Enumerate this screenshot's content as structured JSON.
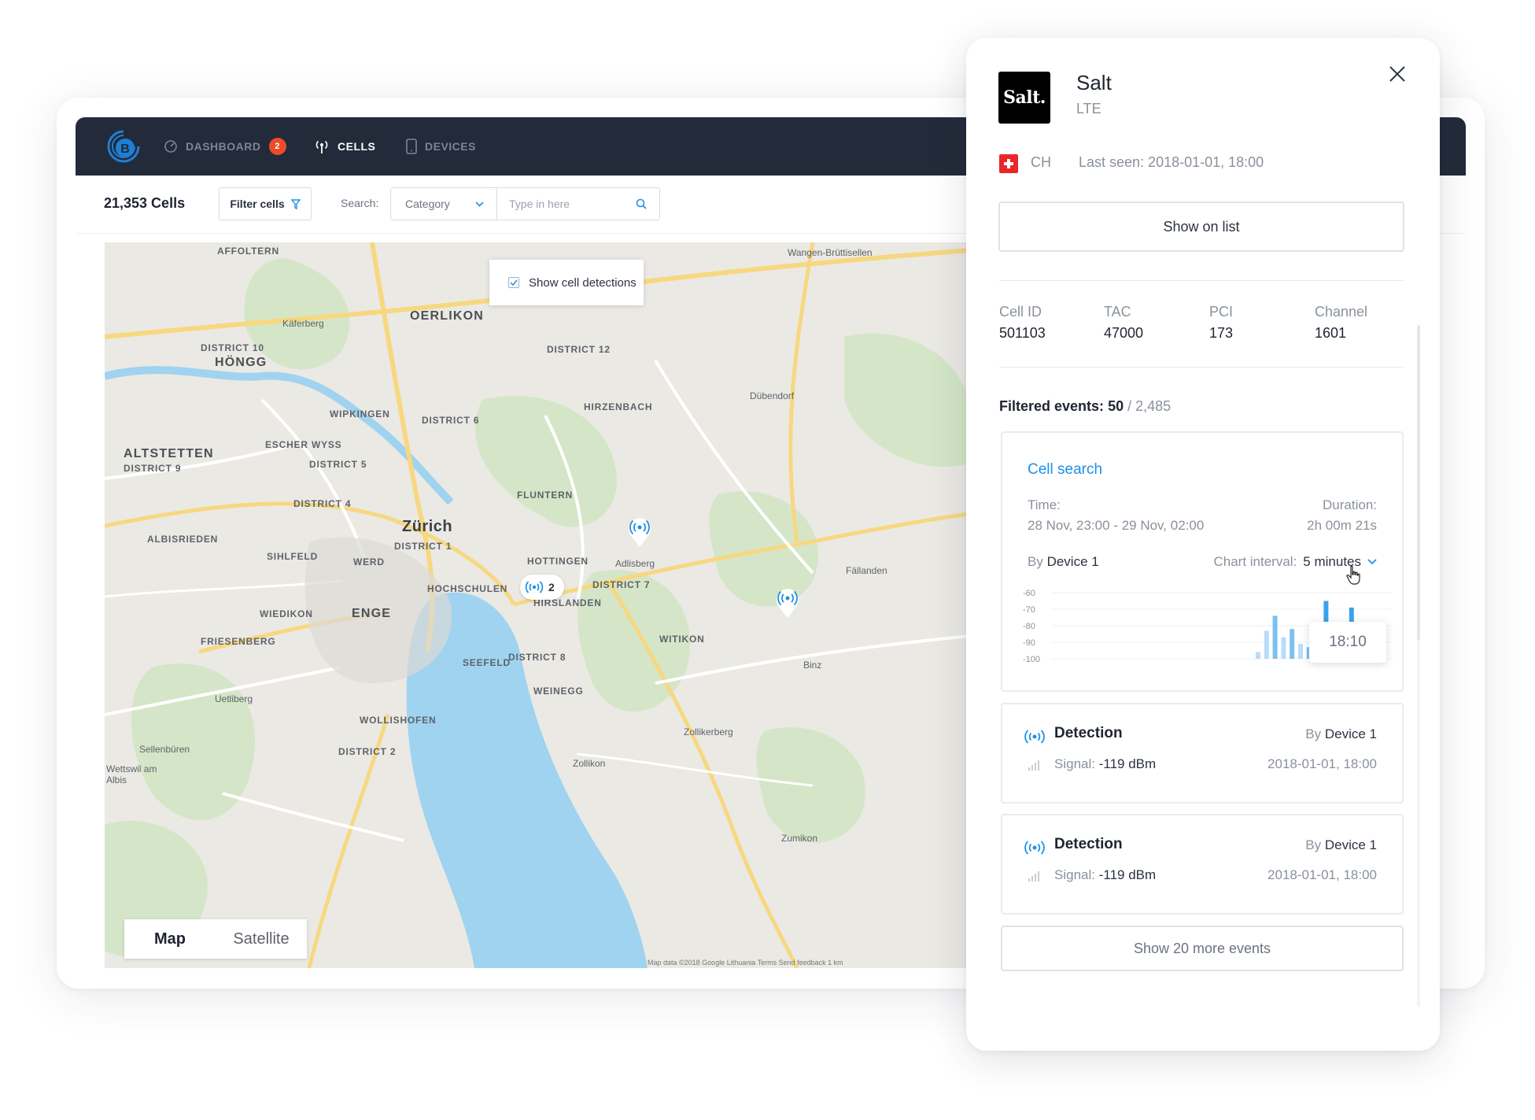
{
  "nav": {
    "items": [
      {
        "label": "DASHBOARD",
        "badge": "2"
      },
      {
        "label": "CELLS"
      },
      {
        "label": "DEVICES"
      }
    ]
  },
  "toolbar": {
    "cells_count": "21,353 Cells",
    "filter_label": "Filter cells",
    "search_label": "Search:",
    "category": "Category",
    "search_placeholder": "Type in here"
  },
  "map": {
    "show_detections_label": "Show cell detections",
    "show_detections_checked": true,
    "toggle": {
      "map": "Map",
      "satellite": "Satellite"
    },
    "cluster_count": "2",
    "attribution": "Map data ©2018 Google   Lithuania   Terms   Send feedback   1 km",
    "labels": {
      "affoltern": "AFFOLTERN",
      "oerlikon": "OERLIKON",
      "kaferberg": "Käferberg",
      "district10": "DISTRICT 10",
      "hongg": "HÖNGG",
      "district12": "DISTRICT 12",
      "wipkingen": "WIPKINGEN",
      "hirzenbach": "HIRZENBACH",
      "dubendorf": "Dübendorf",
      "district6": "DISTRICT 6",
      "escher": "ESCHER WYSS",
      "altstetten": "ALTSTETTEN",
      "district9": "DISTRICT 9",
      "district5": "DISTRICT 5",
      "fluntern": "FLUNTERN",
      "district4": "DISTRICT 4",
      "zurich": "Zürich",
      "district1": "DISTRICT 1",
      "albisrieden": "ALBISRIEDEN",
      "sihlfeld": "SIHLFELD",
      "werd": "WERD",
      "hottingen": "HOTTINGEN",
      "adlisberg": "Adlisberg",
      "fallanden": "Fällanden",
      "hochschulen": "HOCHSCHULEN",
      "hirslanden": "HIRSLANDEN",
      "district7": "DISTRICT 7",
      "wiedikon": "WIEDIKON",
      "enge": "ENGE",
      "friesenberg": "FRIESENBERG",
      "witikon": "WITIKON",
      "district8": "DISTRICT 8",
      "seefeld": "SEEFELD",
      "binz": "Binz",
      "weinegg": "WEINEGG",
      "uetliberg": "Uetliberg",
      "wollishofen": "WOLLISHOFEN",
      "zollikerberg": "Zollikerberg",
      "sellenburen": "Sellenbüren",
      "district2": "DISTRICT 2",
      "wettswil": "Wettswil am Albis",
      "zollikon": "Zollikon",
      "zumikon": "Zumikon",
      "wangen": "Wangen-Brüttisellen"
    }
  },
  "panel": {
    "operator_logo": "Salt.",
    "operator": "Salt",
    "technology": "LTE",
    "country": "CH",
    "last_seen": "Last seen: 2018-01-01, 18:00",
    "show_on_list": "Show on list",
    "meta": [
      {
        "key": "Cell ID",
        "value": "501103"
      },
      {
        "key": "TAC",
        "value": "47000"
      },
      {
        "key": "PCI",
        "value": "173"
      },
      {
        "key": "Channel",
        "value": "1601"
      }
    ],
    "filtered_label": "Filtered events:",
    "filtered_count": "50",
    "filtered_total": "/ 2,485",
    "cell_search": {
      "title": "Cell search",
      "time_label": "Time:",
      "time_value": "28 Nov, 23:00 - 29 Nov, 02:00",
      "duration_label": "Duration:",
      "duration_value": "2h 00m 21s",
      "by_label": "By",
      "device": "Device 1",
      "interval_label": "Chart interval:",
      "interval_value": "5 minutes",
      "tooltip": "18:10"
    },
    "detections": [
      {
        "title": "Detection",
        "by": "By",
        "device": "Device 1",
        "signal_label": "Signal:",
        "signal_value": "-119 dBm",
        "date": "2018-01-01, 18:00"
      },
      {
        "title": "Detection",
        "by": "By",
        "device": "Device 1",
        "signal_label": "Signal:",
        "signal_value": "-119 dBm",
        "date": "2018-01-01, 18:00"
      }
    ],
    "show_more": "Show 20 more events"
  },
  "chart_data": {
    "type": "bar",
    "ylim": [
      -100,
      -60
    ],
    "yticks": [
      "-60",
      "-70",
      "-80",
      "-90",
      "-100"
    ],
    "values": [
      -96,
      -83,
      -74,
      -87,
      -82,
      -91,
      -93,
      -96,
      -65,
      -91,
      -94,
      -69
    ],
    "highlight": [
      false,
      false,
      false,
      false,
      false,
      false,
      false,
      false,
      true,
      false,
      false,
      true
    ],
    "colors": {
      "bar": "#b9dcf7",
      "bar_dark": "#7cc0f0",
      "highlight": "#3ba3ea"
    }
  }
}
